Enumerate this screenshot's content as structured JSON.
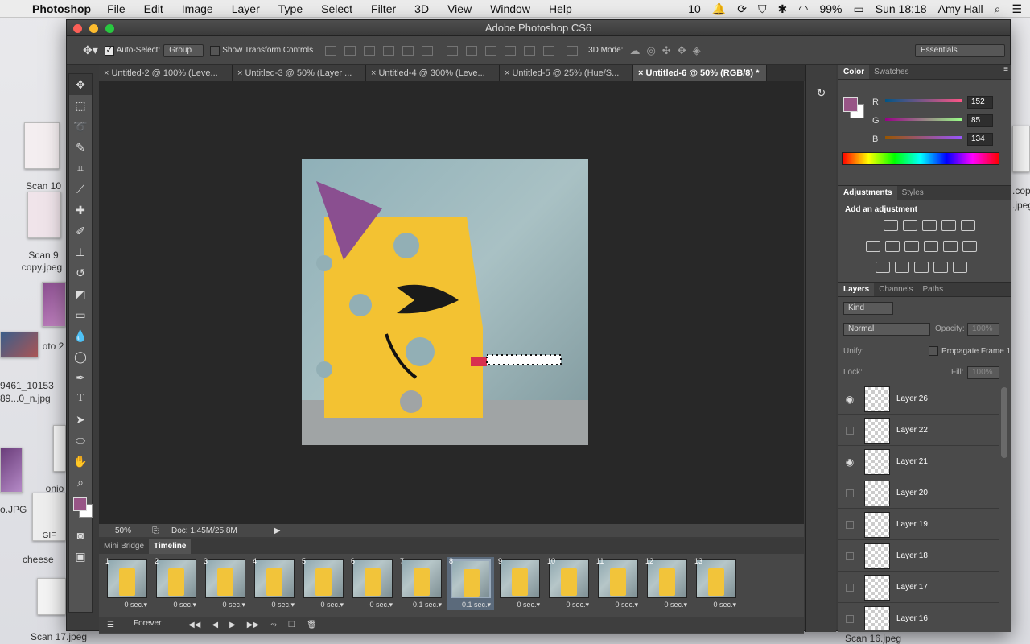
{
  "menubar": {
    "app": "Photoshop",
    "items": [
      "File",
      "Edit",
      "Image",
      "Layer",
      "Type",
      "Select",
      "Filter",
      "3D",
      "View",
      "Window",
      "Help"
    ],
    "status": {
      "adobe_count": "10",
      "battery": "99%",
      "clock": "Sun 18:18",
      "user": "Amy Hall"
    }
  },
  "desktop": {
    "icons": [
      "Scan 10",
      "Scan 9",
      "copy.jpeg",
      "oto 2",
      "9461_10153",
      "89...0_n.jpg",
      "onio",
      "o.JPG",
      "GIF",
      "cheese",
      "Scan 17.jpeg",
      ".cop",
      ".jpeg",
      "Scan 16.jpeg"
    ]
  },
  "window": {
    "title": "Adobe Photoshop CS6"
  },
  "options": {
    "auto_select_label": "Auto-Select:",
    "auto_select_value": "Group",
    "transform_label": "Show Transform Controls",
    "mode3d_label": "3D Mode:",
    "workspace": "Essentials"
  },
  "tabs": [
    {
      "label": "Untitled-2 @ 100% (Leve...",
      "active": false
    },
    {
      "label": "Untitled-3 @ 50% (Layer ...",
      "active": false
    },
    {
      "label": "Untitled-4 @ 300% (Leve...",
      "active": false
    },
    {
      "label": "Untitled-5 @ 25% (Hue/S...",
      "active": false
    },
    {
      "label": "Untitled-6 @ 50% (RGB/8) *",
      "active": true
    }
  ],
  "status": {
    "zoom": "50%",
    "doc": "Doc: 1.45M/25.8M"
  },
  "timeline": {
    "tabs": [
      "Mini Bridge",
      "Timeline"
    ],
    "frames": [
      {
        "n": "1",
        "delay": "0 sec."
      },
      {
        "n": "2",
        "delay": "0 sec."
      },
      {
        "n": "3",
        "delay": "0 sec."
      },
      {
        "n": "4",
        "delay": "0 sec."
      },
      {
        "n": "5",
        "delay": "0 sec."
      },
      {
        "n": "6",
        "delay": "0 sec."
      },
      {
        "n": "7",
        "delay": "0.1 sec."
      },
      {
        "n": "8",
        "delay": "0.1 sec.",
        "selected": true
      },
      {
        "n": "9",
        "delay": "0 sec."
      },
      {
        "n": "10",
        "delay": "0 sec."
      },
      {
        "n": "11",
        "delay": "0 sec."
      },
      {
        "n": "12",
        "delay": "0 sec."
      },
      {
        "n": "13",
        "delay": "0 sec."
      }
    ],
    "loop": "Forever"
  },
  "color_panel": {
    "tabs": [
      "Color",
      "Swatches"
    ],
    "R": {
      "label": "R",
      "value": "152"
    },
    "G": {
      "label": "G",
      "value": "85"
    },
    "B": {
      "label": "B",
      "value": "134"
    },
    "foreground": "#985586"
  },
  "adjustments": {
    "tabs": [
      "Adjustments",
      "Styles"
    ],
    "heading": "Add an adjustment"
  },
  "layers_panel": {
    "tabs": [
      "Layers",
      "Channels",
      "Paths"
    ],
    "kind": "Kind",
    "blend": "Normal",
    "opacity_label": "Opacity:",
    "opacity": "100%",
    "unify_label": "Unify:",
    "propagate": "Propagate Frame 1",
    "lock_label": "Lock:",
    "fill_label": "Fill:",
    "fill": "100%",
    "layers": [
      {
        "name": "Layer 26",
        "visible": true
      },
      {
        "name": "Layer 22",
        "visible": false
      },
      {
        "name": "Layer 21",
        "visible": true
      },
      {
        "name": "Layer 20",
        "visible": false
      },
      {
        "name": "Layer 19",
        "visible": false
      },
      {
        "name": "Layer 18",
        "visible": false
      },
      {
        "name": "Layer 17",
        "visible": false
      },
      {
        "name": "Layer 16",
        "visible": false
      }
    ]
  }
}
